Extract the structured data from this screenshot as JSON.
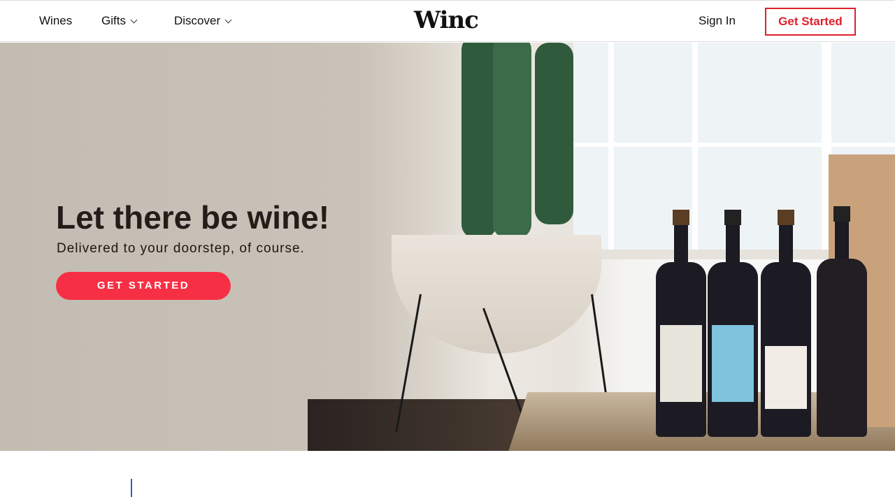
{
  "nav": {
    "wines": "Wines",
    "gifts": "Gifts",
    "discover": "Discover",
    "logo": "Winc",
    "sign_in": "Sign In",
    "get_started": "Get Started"
  },
  "hero": {
    "title": "Let there be wine!",
    "subtitle": "Delivered to your doorstep, of course.",
    "cta": "GET STARTED"
  },
  "colors": {
    "accent": "#f72f45",
    "nav_button": "#e0202a"
  }
}
